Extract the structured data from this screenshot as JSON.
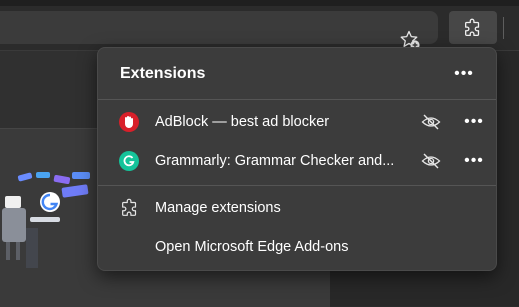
{
  "toolbar": {
    "favorites_icon": "star-plus-icon",
    "extensions_icon": "puzzle-icon"
  },
  "flyout": {
    "title": "Extensions",
    "extensions": [
      {
        "name": "AdBlock — best ad blocker",
        "icon": "adblock-hand-icon",
        "icon_color": "#d8202a"
      },
      {
        "name": "Grammarly: Grammar Checker and...",
        "icon": "grammarly-icon",
        "icon_color": "#15c39a"
      }
    ],
    "menu": [
      {
        "label": "Manage extensions",
        "icon": "puzzle-icon"
      },
      {
        "label": "Open Microsoft Edge Add-ons"
      }
    ],
    "more_glyph": "•••"
  },
  "colors": {
    "background": "#2b2b2b",
    "flyout_bg": "#3c3c3c",
    "adblock": "#d8202a",
    "grammarly": "#15c39a"
  }
}
